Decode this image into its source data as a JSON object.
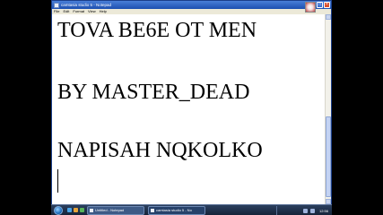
{
  "window": {
    "title": "camtasia studio 5 - Notepad",
    "buttons": {
      "minimize": "_",
      "maximize": "□",
      "close": "×"
    }
  },
  "menu": {
    "items": [
      "File",
      "Edit",
      "Format",
      "View",
      "Help"
    ]
  },
  "document": {
    "lines": [
      "TOVA BE6E OT MEN",
      "BY MASTER_DEAD",
      "NAPISAH NQKOLKO"
    ]
  },
  "taskbar": {
    "tasks": [
      {
        "label": "Untitled - Notepad"
      },
      {
        "label": "camtasia studio 5 - No"
      }
    ],
    "clock": "12:56"
  },
  "colors": {
    "titlebar": "#1d4fb0",
    "menubar": "#ece9d8",
    "taskbar": "#16243a"
  },
  "icons": {
    "app": "notepad-icon",
    "start": "start-orb-icon"
  }
}
